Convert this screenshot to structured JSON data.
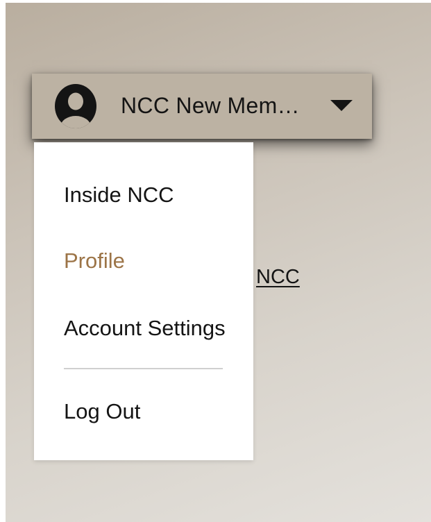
{
  "background": {
    "link_text": "NCC"
  },
  "account": {
    "name": "NCC New Mem…",
    "avatar_icon": "user-circle-icon",
    "caret_icon": "caret-down-icon"
  },
  "menu": {
    "items": [
      {
        "label": "Inside NCC",
        "active": false
      },
      {
        "label": "Profile",
        "active": true
      },
      {
        "label": "Account Settings",
        "active": false
      },
      {
        "label": "Log Out",
        "active": false
      }
    ]
  },
  "colors": {
    "active_item": "#9c7447",
    "trigger_bg": "#bcb2a3",
    "text": "#141414"
  }
}
